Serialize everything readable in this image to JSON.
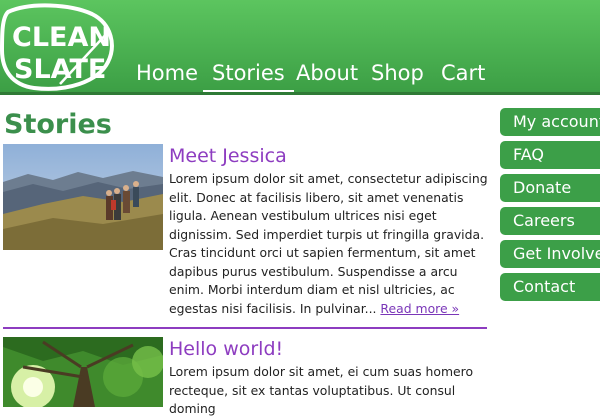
{
  "logo": {
    "line1": "CLEAN",
    "line2": "SLATE"
  },
  "nav": [
    {
      "label": "Home"
    },
    {
      "label": "Stories"
    },
    {
      "label": "About"
    },
    {
      "label": "Shop"
    },
    {
      "label": "Cart"
    }
  ],
  "nav_active": "Stories",
  "page_title": "Stories",
  "stories": [
    {
      "title": "Meet Jessica",
      "body": "Lorem ipsum dolor sit amet, consectetur adipiscing elit. Donec at facilisis libero, sit amet venenatis ligula. Aenean vestibulum ultrices nisi eget dignissim. Sed imperdiet turpis ut fringilla gravida. Cras tincidunt orci ut sapien fermentum, sit amet dapibus purus vestibulum. Suspendisse a arcu enim. Morbi interdum diam et nisl ultricies, ac egestas nisi facilisis. In pulvinar... ",
      "read_more": "Read more »"
    },
    {
      "title": "Hello world!",
      "body": "Lorem ipsum dolor sit amet, ei cum suas homero recteque, sit ex tantas voluptatibus. Ut consul doming"
    }
  ],
  "sidebar": [
    {
      "label": "My account"
    },
    {
      "label": "FAQ"
    },
    {
      "label": "Donate"
    },
    {
      "label": "Careers"
    },
    {
      "label": "Get Involved"
    },
    {
      "label": "Contact"
    }
  ],
  "colors": {
    "header_green": "#4cb454",
    "title_green": "#3b8f4c",
    "story_purple": "#8d3cc0",
    "sidebar_green": "#3c9f48"
  }
}
